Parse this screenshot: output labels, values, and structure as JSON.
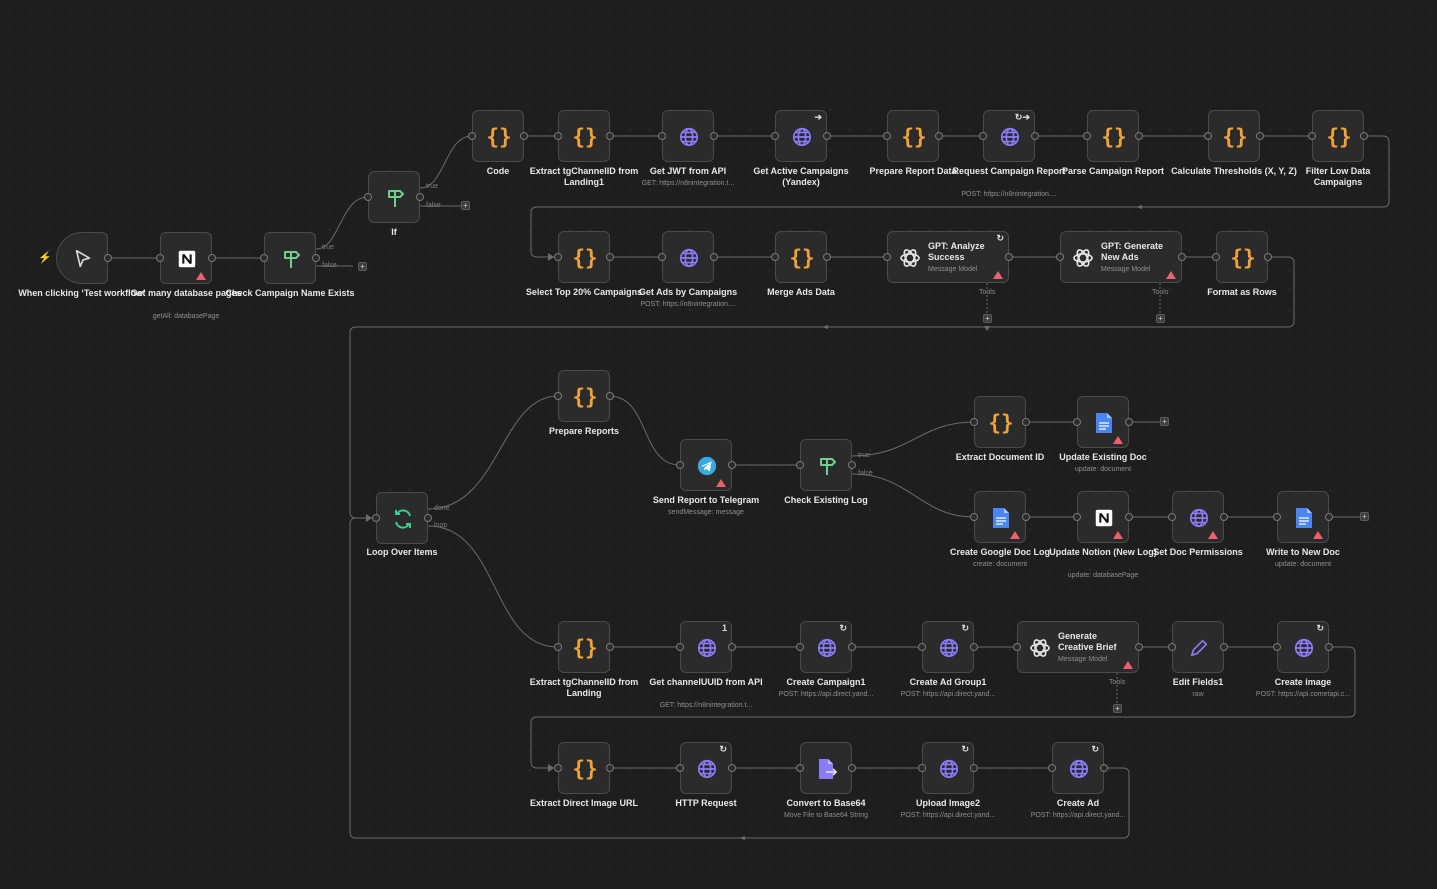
{
  "port_labels": {
    "true": "true",
    "false": "false",
    "done": "done",
    "loop": "loop",
    "tools": "Tools",
    "plus": "+"
  },
  "colors": {
    "code": "#f0a33a",
    "http": "#8b7cf6",
    "if": "#6fd08c",
    "loop": "#3dcf8e",
    "telegram": "#38a9e0",
    "gdoc": "#4a86f3",
    "warning": "#ef5f6b"
  },
  "nodes": {
    "trigger": {
      "label": "When clicking ‘Test workflow’",
      "icon": "cursor-icon"
    },
    "notion_get": {
      "label": "Get many database pages",
      "sub": "getAll: databasePage",
      "icon": "notion-icon"
    },
    "check_campaign": {
      "label": "Check Campaign Name Exists",
      "icon": "if-icon"
    },
    "if1": {
      "label": "If",
      "icon": "if-icon"
    },
    "code": {
      "label": "Code",
      "icon": "code-icon"
    },
    "extract_tg1": {
      "label": "Extract tgChannelID from Landing1",
      "icon": "code-icon"
    },
    "get_jwt": {
      "label": "Get JWT from API",
      "sub": "GET: https://n8nintegration.t...",
      "icon": "http-icon"
    },
    "get_active": {
      "label": "Get Active Campaigns (Yandex)",
      "icon": "http-icon"
    },
    "prepare_report": {
      "label": "Prepare Report Data",
      "icon": "code-icon"
    },
    "request_report": {
      "label": "Request Campaign Report",
      "sub": "POST: https://n8nintegration....",
      "icon": "http-icon"
    },
    "parse_report": {
      "label": "Parse Campaign Report",
      "icon": "code-icon"
    },
    "calc_thresholds": {
      "label": "Calculate Thresholds (X, Y, Z)",
      "icon": "code-icon"
    },
    "filter_low": {
      "label": "Filter Low Data Campaigns",
      "icon": "code-icon"
    },
    "select_top": {
      "label": "Select Top 20% Campaigns",
      "icon": "code-icon"
    },
    "get_ads": {
      "label": "Get Ads by Campaigns",
      "sub": "POST: https://n8nintegration....",
      "icon": "http-icon"
    },
    "merge_ads": {
      "label": "Merge Ads Data",
      "icon": "code-icon"
    },
    "gpt_analyze": {
      "title": "GPT: Analyze Success",
      "sub": "Message Model",
      "icon": "openai-icon"
    },
    "gpt_generate": {
      "title": "GPT: Generate New Ads",
      "sub": "Message Model",
      "icon": "openai-icon"
    },
    "format_rows": {
      "label": "Format as Rows",
      "icon": "code-icon"
    },
    "loop": {
      "label": "Loop Over Items",
      "icon": "loop-icon"
    },
    "prepare_reports": {
      "label": "Prepare Reports",
      "icon": "code-icon"
    },
    "send_telegram": {
      "label": "Send Report to Telegram",
      "sub": "sendMessage: message",
      "icon": "telegram-icon"
    },
    "check_log": {
      "label": "Check Existing Log",
      "icon": "if-icon"
    },
    "extract_doc_id": {
      "label": "Extract Document ID",
      "icon": "code-icon"
    },
    "update_doc": {
      "label": "Update Existing Doc",
      "sub": "update: document",
      "icon": "gdoc-icon"
    },
    "create_gdoc": {
      "label": "Create Google Doc Log",
      "sub": "create: document",
      "icon": "gdoc-icon"
    },
    "update_notion": {
      "label": "Update Notion (New Log)",
      "sub": "update: databasePage",
      "icon": "notion-icon"
    },
    "set_perms": {
      "label": "Set Doc Permissions",
      "icon": "http-icon"
    },
    "write_doc": {
      "label": "Write to New Doc",
      "sub": "update: document",
      "icon": "gdoc-icon"
    },
    "extract_tg": {
      "label": "Extract tgChannelID from Landing",
      "icon": "code-icon"
    },
    "get_uuid": {
      "label": "Get channelUUID from API",
      "sub": "GET: https://n8nintegration.t...",
      "badge": "1",
      "icon": "http-icon"
    },
    "create_campaign": {
      "label": "Create Campaign1",
      "sub": "POST: https://api.direct.yand...",
      "icon": "http-icon"
    },
    "create_adgroup": {
      "label": "Create Ad Group1",
      "sub": "POST: https://api.direct.yand...",
      "icon": "http-icon"
    },
    "gen_brief": {
      "title": "Generate Creative Brief",
      "sub": "Message Model",
      "icon": "openai-icon"
    },
    "edit_fields": {
      "label": "Edit Fields1",
      "sub": "raw",
      "icon": "pencil-icon"
    },
    "create_image": {
      "label": "Create image",
      "sub": "POST: https://api.cometapi.c...",
      "icon": "http-icon"
    },
    "extract_img": {
      "label": "Extract Direct Image URL",
      "icon": "code-icon"
    },
    "http_req": {
      "label": "HTTP Request",
      "icon": "http-icon"
    },
    "to_base64": {
      "label": "Convert to Base64",
      "sub": "Move File to Base64 String",
      "icon": "convert-file-icon"
    },
    "upload_img": {
      "label": "Upload Image2",
      "sub": "POST: https://api.direct.yand...",
      "icon": "http-icon"
    },
    "create_ad": {
      "label": "Create Ad",
      "sub": "POST: https://api.direct.yand...",
      "icon": "http-icon"
    }
  }
}
